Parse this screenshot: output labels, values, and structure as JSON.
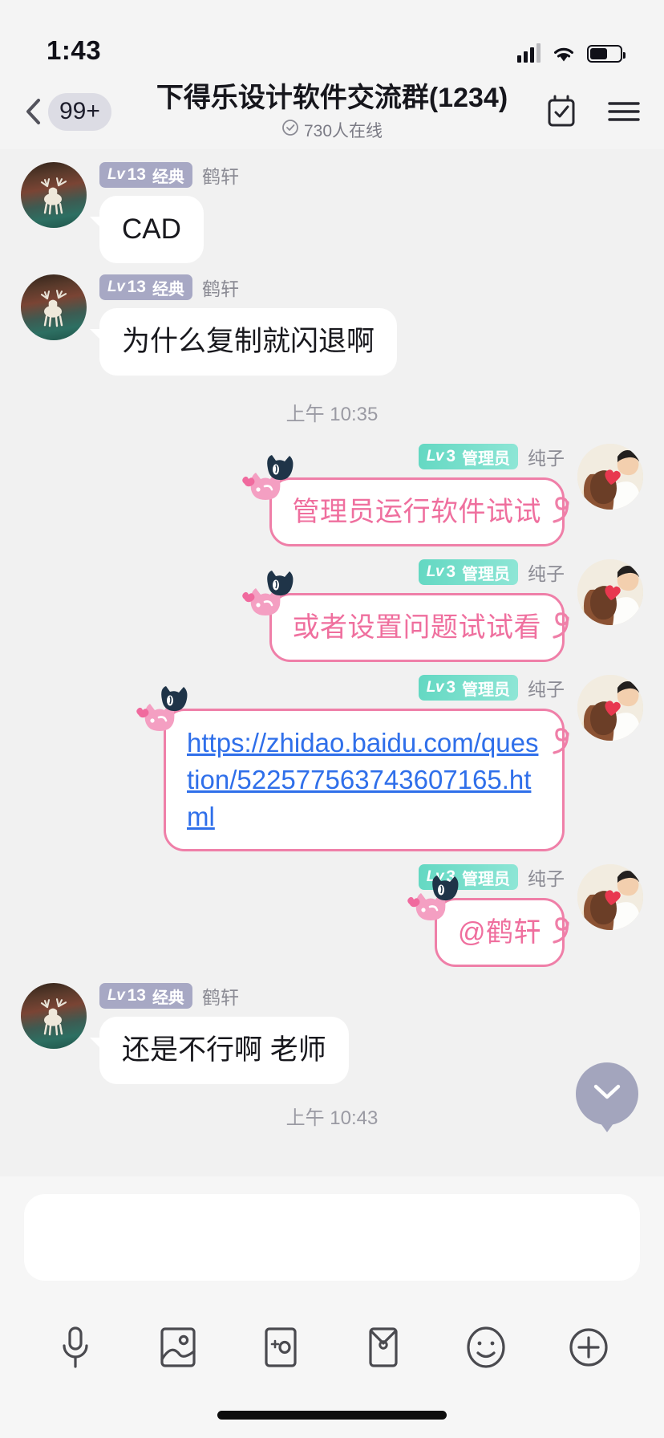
{
  "status_bar": {
    "time": "1:43",
    "signal_icon": "cellular-signal-icon",
    "wifi_icon": "wifi-icon",
    "battery_icon": "battery-icon"
  },
  "nav": {
    "back_icon": "chevron-left-icon",
    "unread_count": "99+",
    "title": "下得乐设计软件交流群(1234)",
    "online_icon": "clock-check-icon",
    "online_text": "730人在线",
    "checklist_icon": "checklist-icon",
    "menu_icon": "hamburger-menu-icon"
  },
  "colors": {
    "page_bg": "#f1f1f1",
    "nav_bg": "#f4f4f4",
    "badge_classic": "#a7a8c4",
    "badge_admin": "#63d8c2",
    "pink_border": "#ef7fa8",
    "pink_text": "#ef6f9e",
    "link_blue": "#2f6fea",
    "scroll_btn": "#a3a5bd"
  },
  "messages": [
    {
      "side": "left",
      "avatar": "deer-avatar",
      "badge_lv": "Lv",
      "badge_num": "13",
      "badge_text": "经典",
      "badge_type": "classic",
      "nick": "鹤轩",
      "type": "text",
      "text": "CAD"
    },
    {
      "side": "left",
      "avatar": "deer-avatar",
      "badge_lv": "Lv",
      "badge_num": "13",
      "badge_text": "经典",
      "badge_type": "classic",
      "nick": "鹤轩",
      "type": "text",
      "text": "为什么复制就闪退啊"
    },
    {
      "side": "divider",
      "text": "上午 10:35"
    },
    {
      "side": "right",
      "avatar": "chunzi-avatar",
      "badge_lv": "Lv",
      "badge_num": "3",
      "badge_text": "管理员",
      "badge_type": "admin",
      "nick": "纯子",
      "type": "text",
      "text": "管理员运行软件试试"
    },
    {
      "side": "right",
      "avatar": "chunzi-avatar",
      "badge_lv": "Lv",
      "badge_num": "3",
      "badge_text": "管理员",
      "badge_type": "admin",
      "nick": "纯子",
      "type": "text",
      "text": "或者设置问题试试看"
    },
    {
      "side": "right",
      "avatar": "chunzi-avatar",
      "badge_lv": "Lv",
      "badge_num": "3",
      "badge_text": "管理员",
      "badge_type": "admin",
      "nick": "纯子",
      "type": "link",
      "text": "https://zhidao.baidu.com/question/522577563743607165.html"
    },
    {
      "side": "right",
      "avatar": "chunzi-avatar",
      "badge_lv": "Lv",
      "badge_num": "3",
      "badge_text": "管理员",
      "badge_type": "admin",
      "nick": "纯子",
      "type": "text",
      "text": "@鹤轩"
    },
    {
      "side": "left",
      "avatar": "deer-avatar",
      "badge_lv": "Lv",
      "badge_num": "13",
      "badge_text": "经典",
      "badge_type": "classic",
      "nick": "鹤轩",
      "type": "text",
      "text": "还是不行啊 老师"
    },
    {
      "side": "divider",
      "text": "上午 10:43"
    }
  ],
  "scroll_button": {
    "icon": "chevron-down-icon"
  },
  "dock": {
    "input_value": "",
    "input_placeholder": "",
    "tools": [
      {
        "icon": "microphone-icon",
        "name": "voice"
      },
      {
        "icon": "image-icon",
        "name": "album"
      },
      {
        "icon": "sticker-icon",
        "name": "sticker"
      },
      {
        "icon": "red-envelope-icon",
        "name": "red-packet"
      },
      {
        "icon": "smiley-icon",
        "name": "emoji"
      },
      {
        "icon": "plus-icon",
        "name": "more"
      }
    ]
  }
}
